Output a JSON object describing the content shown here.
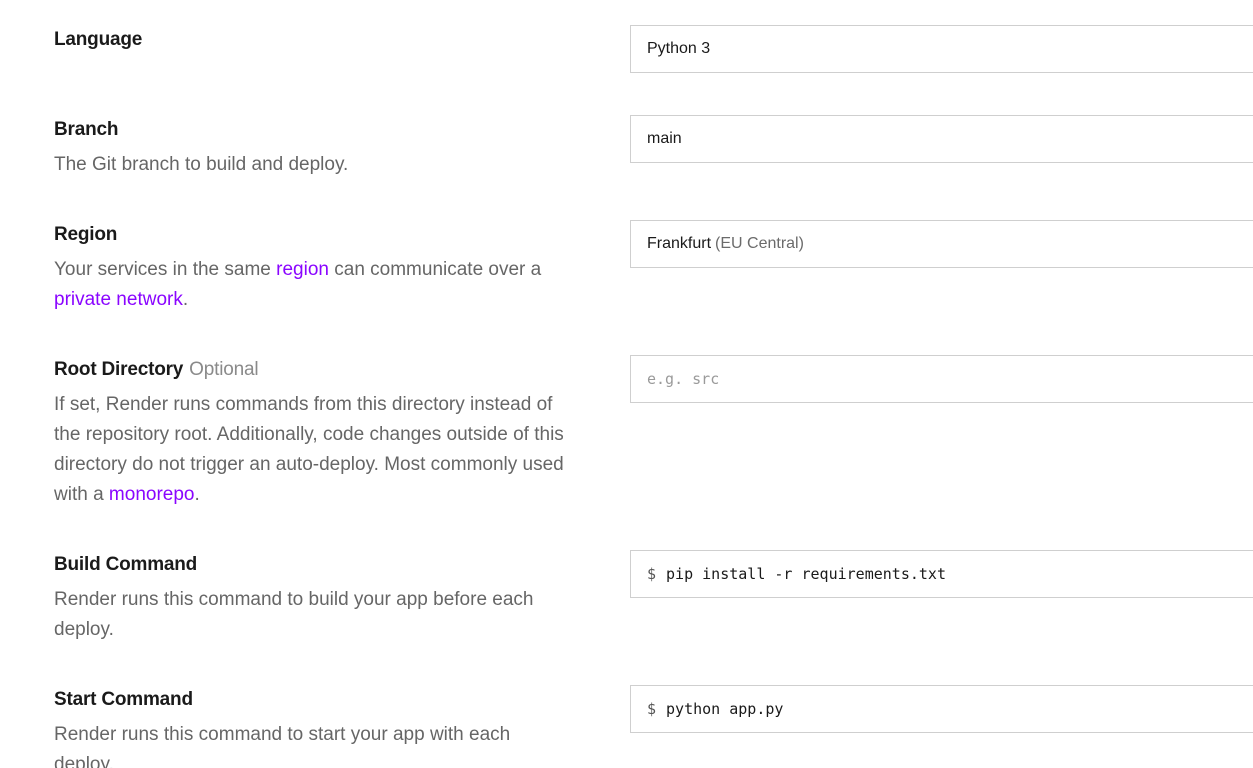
{
  "fields": {
    "language": {
      "title": "Language",
      "value": "Python 3"
    },
    "branch": {
      "title": "Branch",
      "description": "The Git branch to build and deploy.",
      "value": "main"
    },
    "region": {
      "title": "Region",
      "description_before": "Your services in the same ",
      "link_region": "region",
      "description_middle": " can communicate over a ",
      "link_private_network": "private network",
      "description_after": ".",
      "value": "Frankfurt",
      "value_detail": "(EU Central)"
    },
    "root_directory": {
      "title": "Root Directory",
      "optional_label": "Optional",
      "description_before": "If set, Render runs commands from this directory instead of the repository root. Additionally, code changes outside of this directory do not trigger an auto-deploy. Most commonly used with a ",
      "link_monorepo": "monorepo",
      "description_after": ".",
      "placeholder": "e.g. src"
    },
    "build_command": {
      "title": "Build Command",
      "description": "Render runs this command to build your app before each deploy.",
      "prompt": "$",
      "value": "pip install -r requirements.txt"
    },
    "start_command": {
      "title": "Start Command",
      "description": "Render runs this command to start your app with each deploy.",
      "prompt": "$",
      "value": "python app.py"
    }
  },
  "colors": {
    "link": "#8a05ff",
    "description": "#666666",
    "border": "#cfcfcf"
  }
}
